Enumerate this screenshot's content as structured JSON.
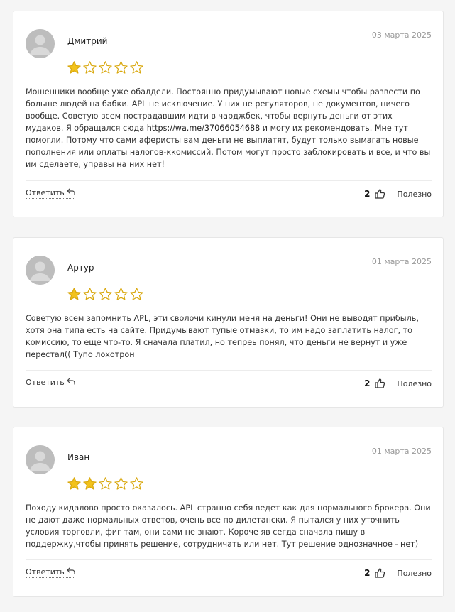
{
  "colors": {
    "star_filled": "#F2C21B",
    "star_empty_stroke": "#D9A80E",
    "avatar": "#BDBDBD"
  },
  "icons": {
    "avatar": "user-avatar-icon",
    "star": "star-icon",
    "reply": "reply-arrow-icon",
    "like": "thumbs-up-icon"
  },
  "reviews": [
    {
      "author": "Дмитрий",
      "date": "03 марта 2025",
      "rating": 1,
      "max_rating": 5,
      "text_before": "Мошенники вообще уже обалдели. Постоянно придумывают новые схемы чтобы развести по больше людей на бабки. APL не исключение. У них не регуляторов, не документов, ничего вообще. Советую всем пострадавшим идти в чарджбек, чтобы вернуть деньги от этих мудаков. Я обращался сюда ",
      "link": "https://wa.me/37066054688",
      "text_after": " и могу их рекомендовать. Мне тут помогли. Потому что сами аферисты вам деньги не выплатят, будут только вымагать новые пополнения или оплаты налогов-ккомиссий. Потом могут просто заблокировать и все, и что вы им сделаете, управы на них нет!",
      "reply_label": "Ответить",
      "likes": "2",
      "useful_label": "Полезно"
    },
    {
      "author": "Артур",
      "date": "01 марта 2025",
      "rating": 1,
      "max_rating": 5,
      "text": "Советую всем запомнить APL, эти сволочи кинули меня на деньги! Они не выводят прибыль, хотя она типа есть на сайте. Придумывают тупые отмазки, то им надо заплатить налог, то комиссию, то еще что-то. Я сначала платил, но тепреь понял, что деньги не вернут и уже перестал(( Тупо лохотрон",
      "reply_label": "Ответить",
      "likes": "2",
      "useful_label": "Полезно"
    },
    {
      "author": "Иван",
      "date": "01 марта 2025",
      "rating": 2,
      "max_rating": 5,
      "text": "Походу кидалово просто оказалось. APL странно себя ведет как для нормального брокера. Они не дают даже нормальных ответов, очень все по дилетански. Я пытался у них уточнить условия торговли, фиг там, они сами не знают. Короче яв сегда сначала пишу в поддержку,чтобы принять решение, сотрудничать или нет. Тут решение однозначное - нет)",
      "reply_label": "Ответить",
      "likes": "2",
      "useful_label": "Полезно"
    }
  ]
}
